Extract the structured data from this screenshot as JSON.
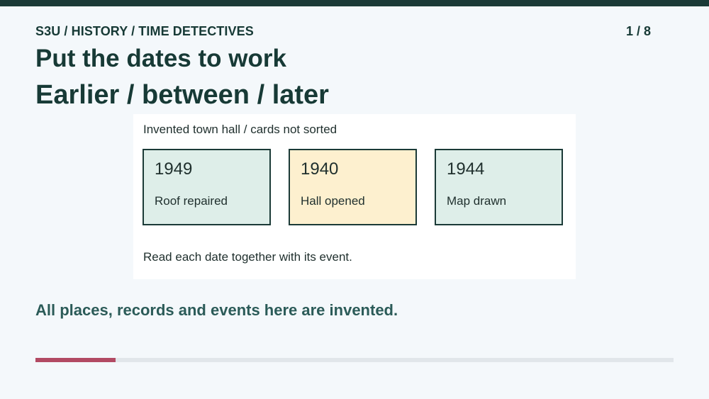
{
  "header": {
    "breadcrumb": "S3U / HISTORY / TIME DETECTIVES",
    "page_counter": "1 / 8"
  },
  "title": "Put the dates to work",
  "subtitle": "Earlier / between / later",
  "panel": {
    "caption": "Invented town hall / cards not sorted",
    "cards": [
      {
        "year": "1949",
        "event": "Roof repaired",
        "color": "#deeee9"
      },
      {
        "year": "1940",
        "event": "Hall opened",
        "color": "#fdf0cf"
      },
      {
        "year": "1944",
        "event": "Map drawn",
        "color": "#deeee9"
      }
    ],
    "hint": "Read each date together with its event."
  },
  "footnote": "All places, records and events here are invented.",
  "progress": {
    "current": 1,
    "total": 8,
    "fill_color": "#b24a63"
  }
}
